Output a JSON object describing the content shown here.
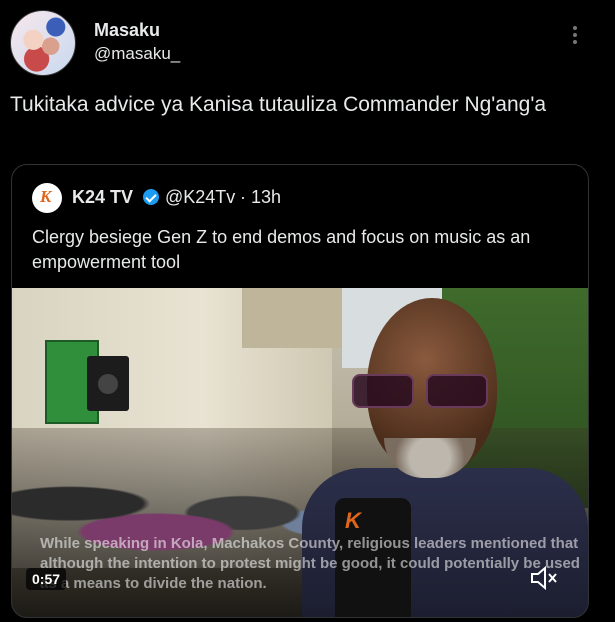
{
  "post": {
    "author": {
      "name": "Masaku",
      "handle": "@masaku_"
    },
    "text": "Tukitaka advice ya Kanisa tutauliza Commander Ng'ang'a",
    "more_icon": "more-vertical-icon"
  },
  "quote": {
    "author": {
      "name": "K24 TV",
      "handle": "@K24Tv",
      "time": "· 13h",
      "verified": true
    },
    "text": "Clergy besiege Gen Z to end demos and focus on music as an empowerment tool",
    "video": {
      "caption": "While speaking in Kola, Machakos County, religious leaders mentioned that although the intention to protest might be good, it could potentially be used as a means to divide the nation.",
      "duration": "0:57",
      "mute_icon": "speaker-muted-icon"
    }
  },
  "colors": {
    "background": "#000000",
    "text": "#e7e9ea",
    "muted": "#71767b",
    "verified": "#1d9bf0",
    "border": "#2f3336"
  }
}
